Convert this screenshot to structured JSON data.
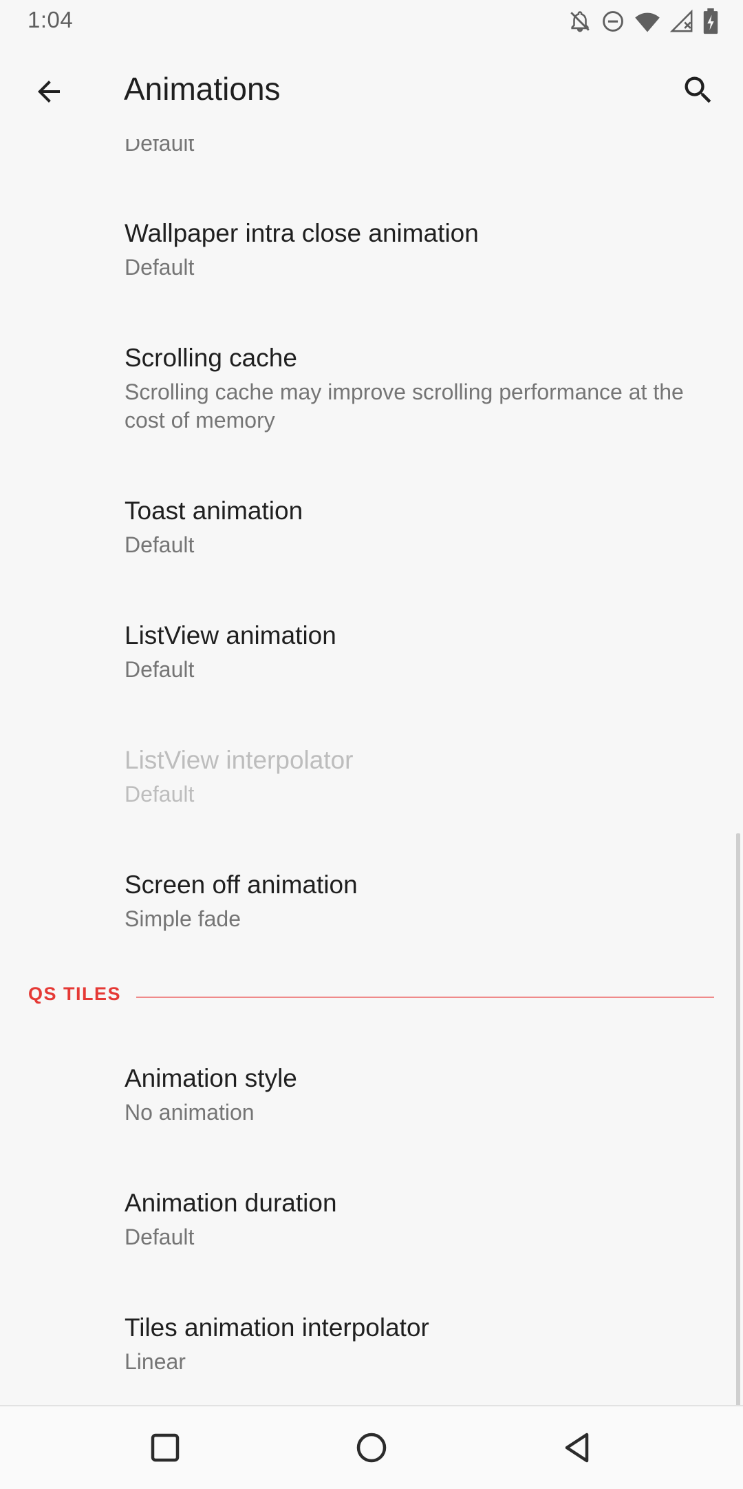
{
  "status_bar": {
    "time": "1:04",
    "icons": [
      "notifications-off-icon",
      "do-not-disturb-icon",
      "wifi-icon",
      "cellular-signal-icon",
      "battery-charging-icon"
    ]
  },
  "app_bar": {
    "title": "Animations",
    "back_icon": "arrow-back-icon",
    "search_icon": "search-icon"
  },
  "preferences_top": {
    "partial_summary": "Default",
    "items": [
      {
        "title": "Wallpaper intra close animation",
        "summary": "Default",
        "enabled": true
      },
      {
        "title": "Scrolling cache",
        "summary": "Scrolling cache may improve scrolling performance at the cost of memory",
        "enabled": true
      },
      {
        "title": "Toast animation",
        "summary": "Default",
        "enabled": true
      },
      {
        "title": "ListView animation",
        "summary": "Default",
        "enabled": true
      },
      {
        "title": "ListView interpolator",
        "summary": "Default",
        "enabled": false
      },
      {
        "title": "Screen off animation",
        "summary": "Simple fade",
        "enabled": true
      }
    ]
  },
  "qs_tiles": {
    "header": "QS TILES",
    "items": [
      {
        "title": "Animation style",
        "summary": "No animation"
      },
      {
        "title": "Animation duration",
        "summary": "Default"
      },
      {
        "title": "Tiles animation interpolator",
        "summary": "Linear"
      }
    ]
  },
  "nav_bar": {
    "recents_icon": "recents-square-icon",
    "home_icon": "home-circle-icon",
    "back_icon": "back-triangle-icon"
  },
  "colors": {
    "accent": "#e53935",
    "background": "#f7f7f7",
    "title_text": "#1f1f1f",
    "summary_text": "#757575",
    "disabled_text": "#bdbdbd"
  }
}
